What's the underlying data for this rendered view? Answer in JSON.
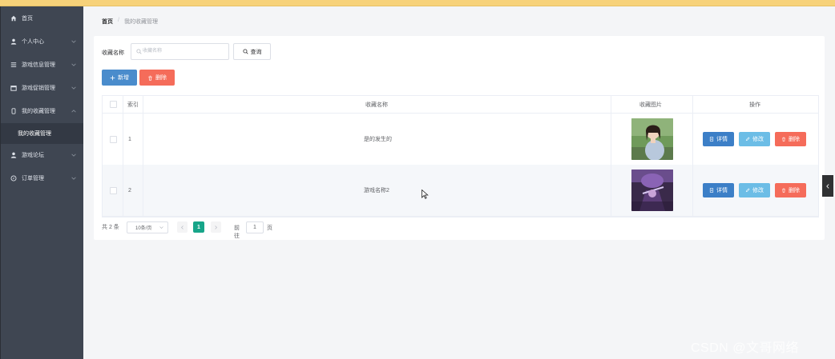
{
  "colors": {
    "accent": "#4a8ccc",
    "danger": "#f56c5a",
    "sidebar_bg": "#3f4652",
    "page_active": "#17a589",
    "top_stripe": "#f7d27a"
  },
  "sidebar": {
    "items": [
      {
        "label": "首页",
        "icon": "home-icon",
        "expandable": false
      },
      {
        "label": "个人中心",
        "icon": "user-icon",
        "expandable": true
      },
      {
        "label": "游戏信息管理",
        "icon": "list-icon",
        "expandable": true
      },
      {
        "label": "游戏促销管理",
        "icon": "calendar-icon",
        "expandable": true
      },
      {
        "label": "我的收藏管理",
        "icon": "bookmark-icon",
        "expandable": true,
        "expanded": true
      },
      {
        "label": "游戏论坛",
        "icon": "user-icon",
        "expandable": true
      },
      {
        "label": "订单管理",
        "icon": "compass-icon",
        "expandable": true
      }
    ],
    "active_sub_item": "我的收藏管理"
  },
  "breadcrumb": {
    "home": "首页",
    "separator": "/",
    "current": "我的收藏管理"
  },
  "search": {
    "label": "收藏名称",
    "placeholder": "收藏名称",
    "value": "",
    "button_label": "查询"
  },
  "toolbar": {
    "add_label": "新增",
    "delete_label": "删除"
  },
  "table": {
    "headers": {
      "index": "索引",
      "name": "收藏名称",
      "image": "收藏图片",
      "actions": "操作"
    },
    "rows": [
      {
        "index": "1",
        "name": "是的发生的",
        "image": "photo-girl-outdoors"
      },
      {
        "index": "2",
        "name": "游戏名称2",
        "image": "photo-purple-character"
      }
    ],
    "actions": {
      "detail": "详情",
      "edit": "修改",
      "delete": "删除"
    }
  },
  "pagination": {
    "total": "共 2 条",
    "page_size": "10条/页",
    "current_page": "1",
    "goto_label": "前往",
    "goto_value": "1",
    "page_unit": "页"
  },
  "watermark": "CSDN @文哥网络"
}
